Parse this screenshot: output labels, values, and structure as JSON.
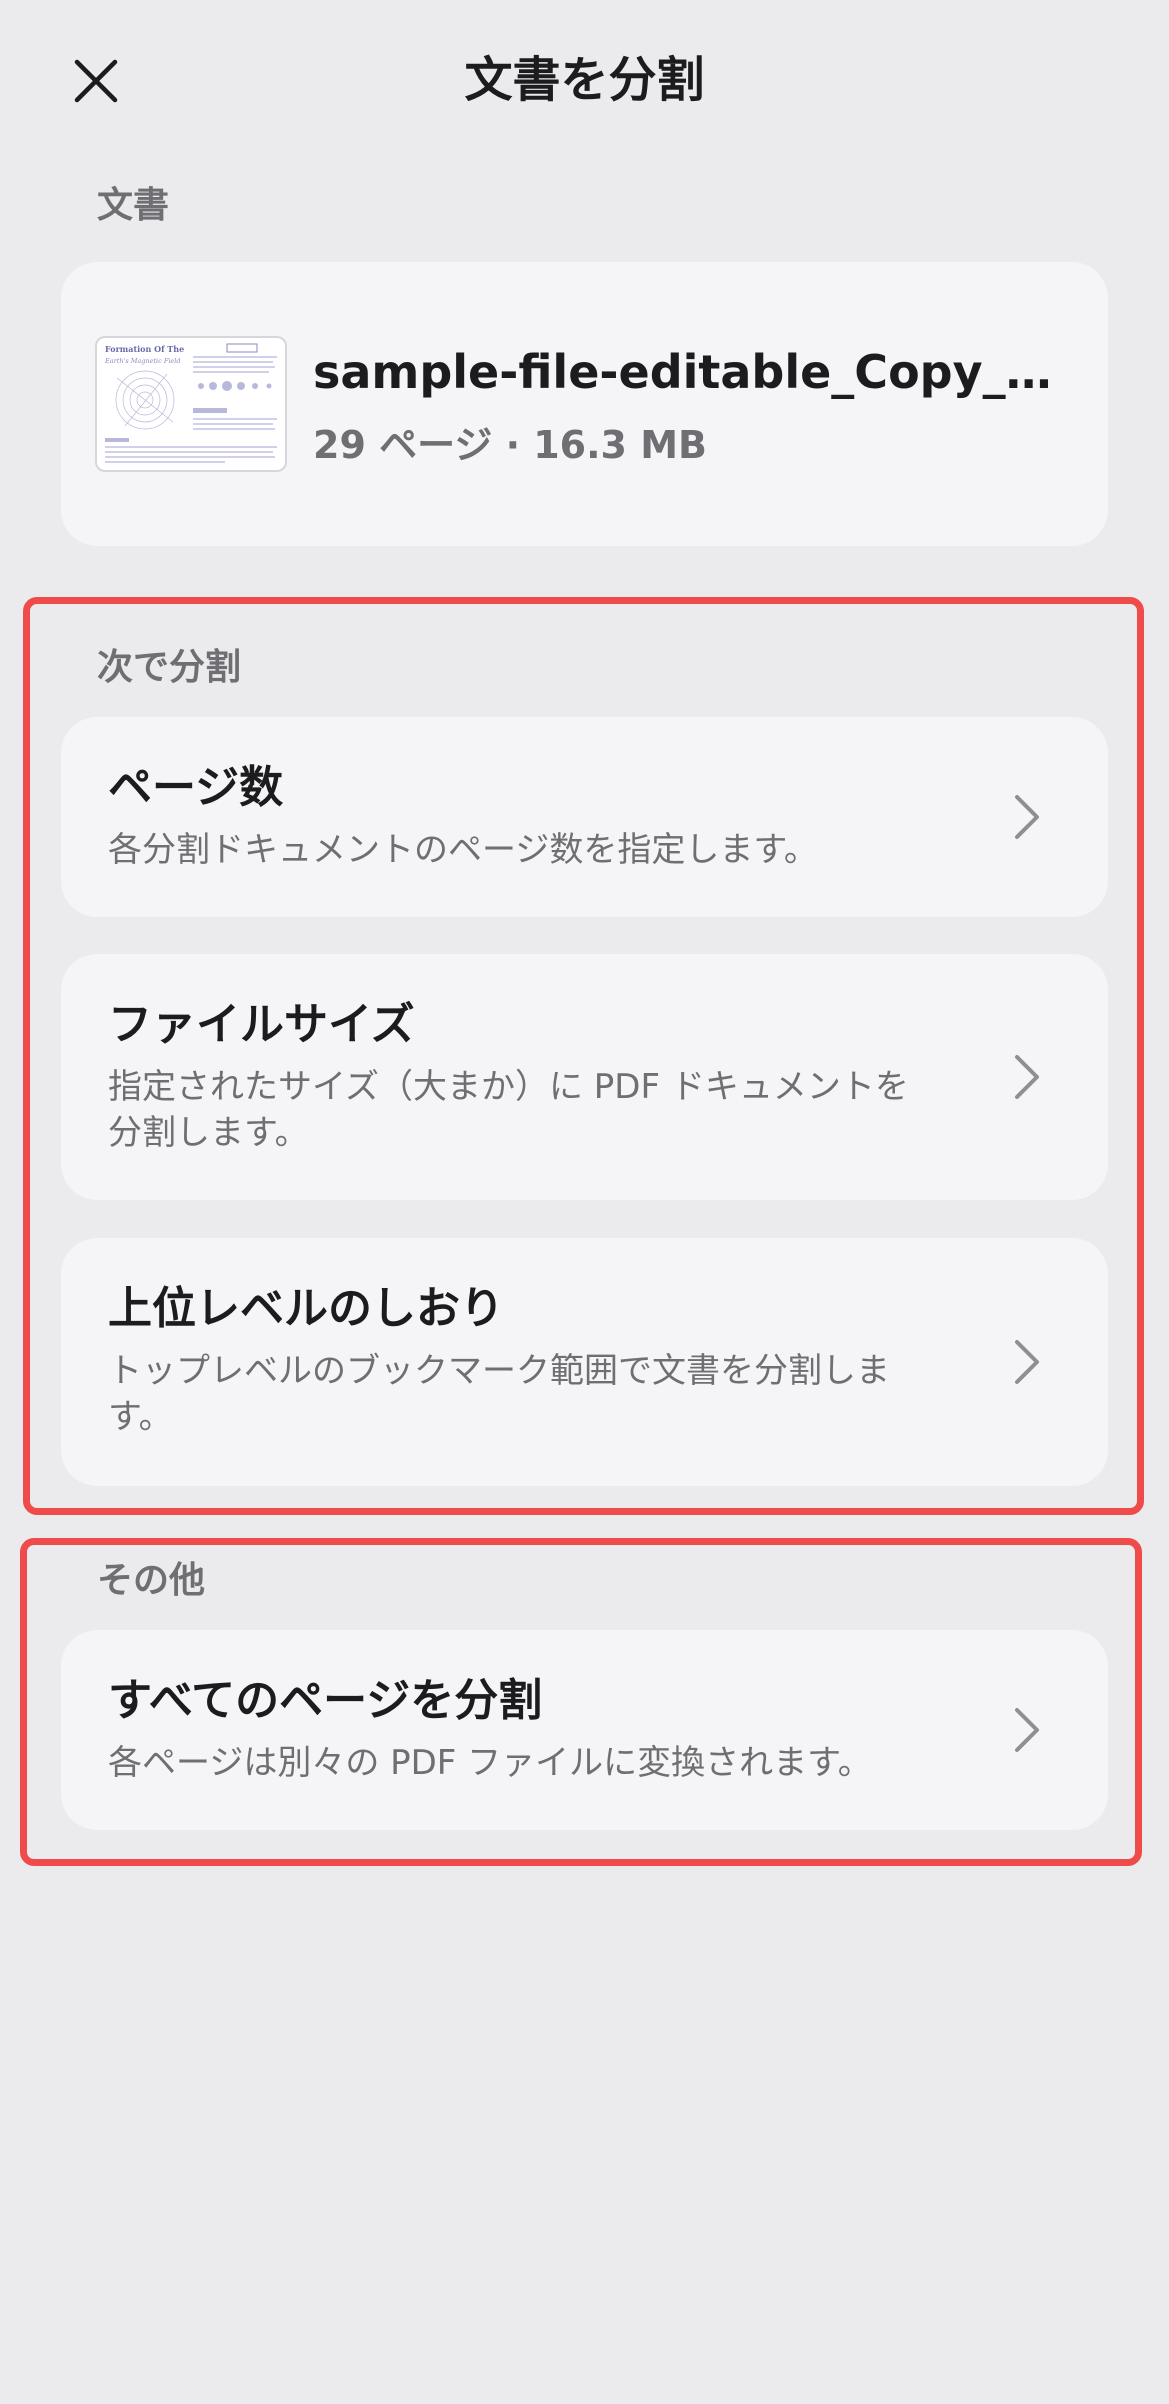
{
  "header": {
    "title": "文書を分割",
    "close_icon": "close-icon"
  },
  "document_section": {
    "label": "文書",
    "file": {
      "name": "sample-file-editable_Copy_Co...",
      "meta": "29 ページ · 16.3 MB",
      "thumbnail_title_line1": "Formation Of The",
      "thumbnail_title_line2": "Earth's Magnetic Field"
    }
  },
  "split_by_section": {
    "label": "次で分割",
    "options": [
      {
        "title": "ページ数",
        "description": "各分割ドキュメントのページ数を指定します。",
        "icon": "chevron-right-icon"
      },
      {
        "title": "ファイルサイズ",
        "description": "指定されたサイズ（大まか）に PDF ドキュメントを分割します。",
        "icon": "chevron-right-icon"
      },
      {
        "title": "上位レベルのしおり",
        "description": "トップレベルのブックマーク範囲で文書を分割します。",
        "icon": "chevron-right-icon"
      }
    ]
  },
  "other_section": {
    "label": "その他",
    "options": [
      {
        "title": "すべてのページを分割",
        "description": "各ページは別々の PDF ファイルに変換されます。",
        "icon": "chevron-right-icon"
      }
    ]
  },
  "colors": {
    "background": "#ebebed",
    "card": "#f5f5f7",
    "highlight": "#ef4b4b",
    "secondary_text": "#6e6e73",
    "primary_text": "#1c1c1e"
  }
}
